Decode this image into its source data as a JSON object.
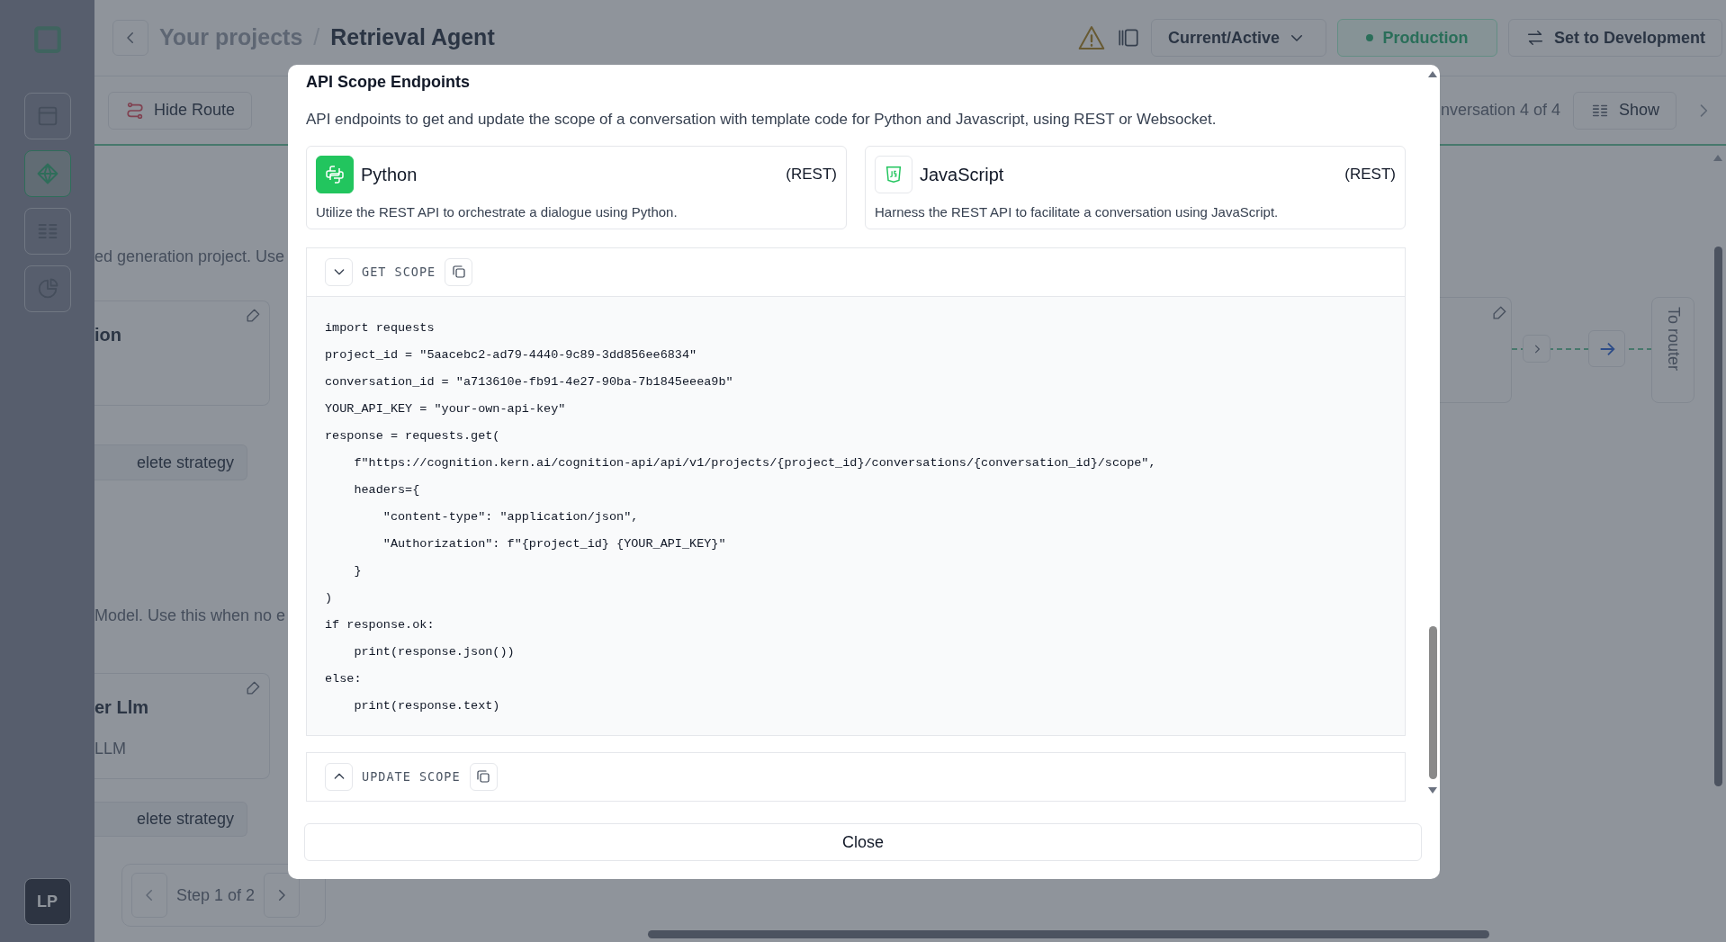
{
  "sidebar": {
    "items": [
      {
        "selected": false
      },
      {
        "selected": true
      },
      {
        "selected": false
      },
      {
        "selected": false
      }
    ],
    "avatar": "LP"
  },
  "header": {
    "breadcrumb": [
      "Your projects",
      "Retrieval Agent"
    ],
    "separator": "/",
    "status_select": "Current/Active",
    "production": "Production",
    "set_development": "Set to Development"
  },
  "toolbar": {
    "hide_route": "Hide Route",
    "conversation": "nversation 4 of 4",
    "show": "Show"
  },
  "canvas": {
    "blocks": [
      {
        "kind": "text",
        "text": "ed generation project. Use"
      },
      {
        "kind": "card",
        "title": "ion"
      },
      {
        "kind": "button",
        "text": "elete strategy"
      },
      {
        "kind": "text",
        "text": "Model. Use this when no e"
      },
      {
        "kind": "card",
        "title": "er Llm",
        "subtitle": "LLM"
      },
      {
        "kind": "button",
        "text": "elete strategy"
      }
    ],
    "pager": "Step 1 of 2",
    "side_tab": "To router"
  },
  "modal": {
    "title": "API Scope Endpoints",
    "description": "API endpoints to get and update the scope of a conversation with template code for Python and Javascript, using REST or Websocket.",
    "languages": [
      {
        "name": "Python",
        "protocol": "(REST)",
        "description": "Utilize the REST API to orchestrate a dialogue using Python.",
        "selected": true
      },
      {
        "name": "JavaScript",
        "protocol": "(REST)",
        "description": "Harness the REST API to facilitate a conversation using JavaScript.",
        "selected": false
      }
    ],
    "sections": [
      {
        "label": "GET SCOPE",
        "expanded": true,
        "code": [
          "import requests",
          "project_id = \"5aacebc2-ad79-4440-9c89-3dd856ee6834\"",
          "conversation_id = \"a713610e-fb91-4e27-90ba-7b1845eeea9b\"",
          "YOUR_API_KEY = \"your-own-api-key\"",
          "response = requests.get(",
          "    f\"https://cognition.kern.ai/cognition-api/api/v1/projects/{project_id}/conversations/{conversation_id}/scope\",",
          "    headers={",
          "        \"content-type\": \"application/json\",",
          "        \"Authorization\": f\"{project_id} {YOUR_API_KEY}\"",
          "    }",
          ")",
          "if response.ok:",
          "    print(response.json())",
          "else:",
          "    print(response.text)"
        ]
      },
      {
        "label": "UPDATE SCOPE",
        "expanded": false
      }
    ],
    "close": "Close"
  }
}
